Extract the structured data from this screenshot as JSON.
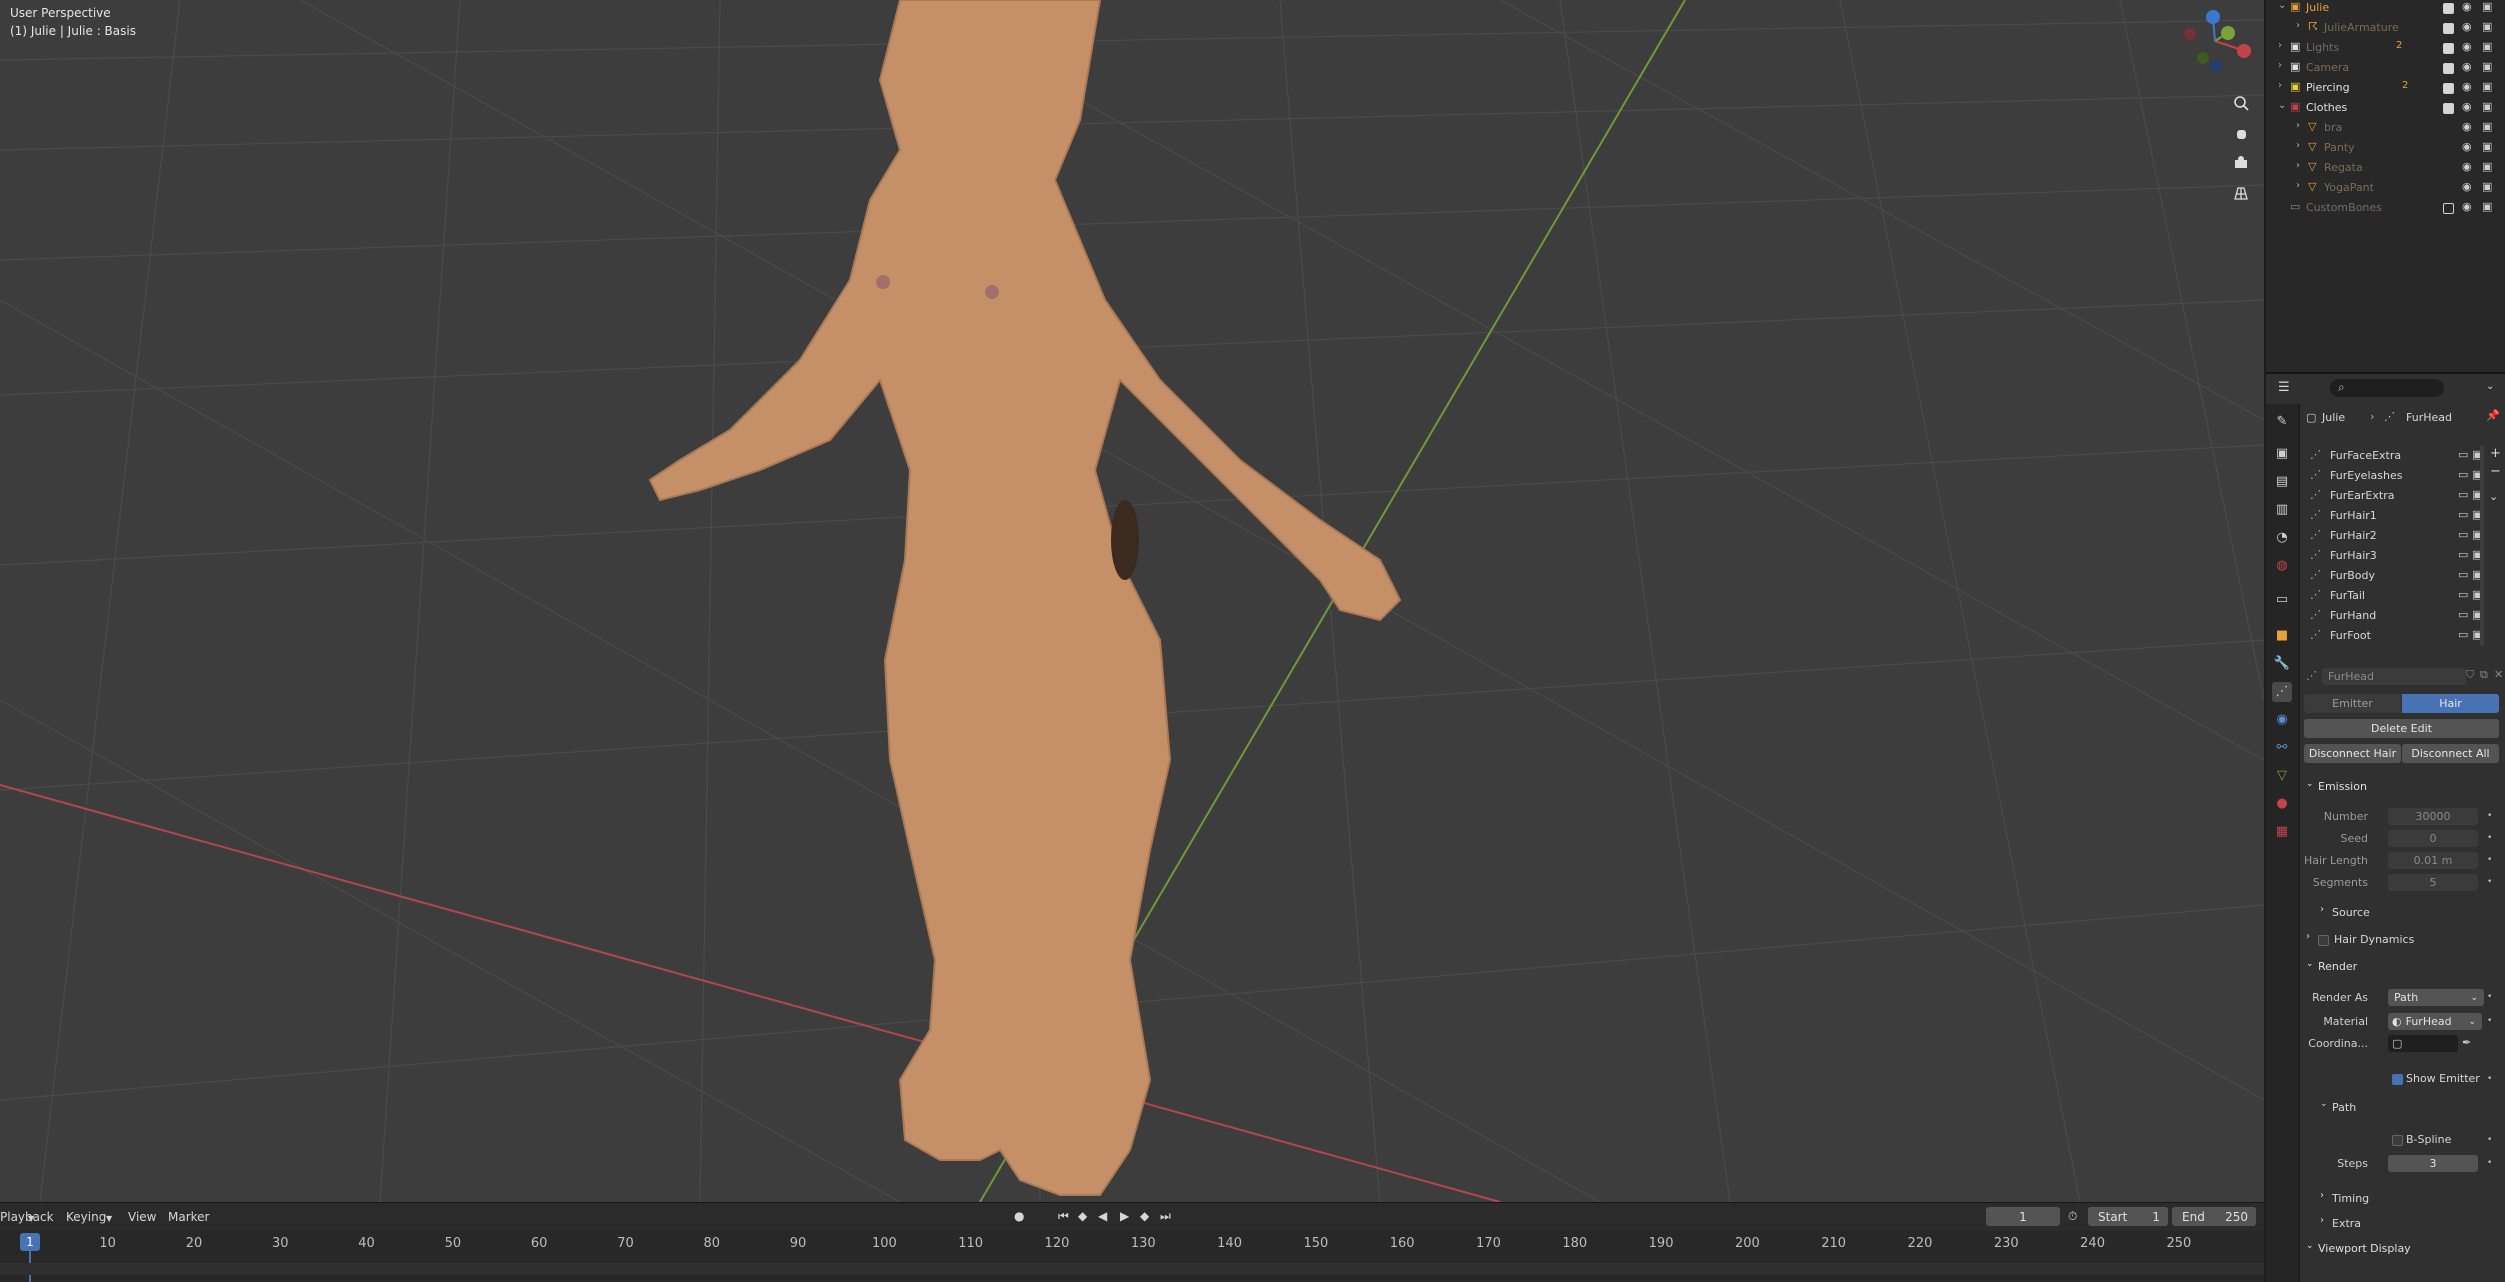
{
  "viewport": {
    "view_name": "User Perspective",
    "object_info": "(1) Julie | Julie : Basis",
    "gizmo": {
      "x_label": "X",
      "y_label": "Y",
      "z_label": "Z"
    }
  },
  "timeline": {
    "menus": [
      "Playback",
      "Keying",
      "View",
      "Marker"
    ],
    "current_frame": "1",
    "start_label": "Start",
    "start_value": "1",
    "end_label": "End",
    "end_value": "250",
    "ticks": [
      "1",
      "10",
      "20",
      "30",
      "40",
      "50",
      "60",
      "70",
      "80",
      "90",
      "100",
      "110",
      "120",
      "130",
      "140",
      "150",
      "160",
      "170",
      "180",
      "190",
      "200",
      "210",
      "220",
      "230",
      "240",
      "250"
    ]
  },
  "outliner": {
    "rows": [
      {
        "label": "Julie",
        "color": "#e8a23a"
      },
      {
        "label": "JulieArmature",
        "color": "#7a6a5a"
      },
      {
        "label": "Lights",
        "color": "#7a6a5a"
      },
      {
        "label": "Camera",
        "color": "#7a6a5a"
      },
      {
        "label": "Piercing",
        "color": "#e0e0e0"
      },
      {
        "label": "Clothes",
        "color": "#e0e0e0"
      },
      {
        "label": "bra",
        "color": "#7a6a5a"
      },
      {
        "label": "Panty",
        "color": "#7a6a5a"
      },
      {
        "label": "Regata",
        "color": "#7a6a5a"
      },
      {
        "label": "YogaPant",
        "color": "#7a6a5a"
      },
      {
        "label": "CustomBones",
        "color": "#7a6a5a"
      }
    ],
    "badges": {
      "lights": "2",
      "piercing": "2"
    }
  },
  "properties": {
    "breadcrumb_object": "Julie",
    "breadcrumb_data": "FurHead",
    "particle_systems": [
      "FurFaceExtra",
      "FurEyelashes",
      "FurEarExtra",
      "FurHair1",
      "FurHair2",
      "FurHair3",
      "FurBody",
      "FurTail",
      "FurHand",
      "FurFoot"
    ],
    "active_system": "FurHead",
    "type_tabs": [
      "Emitter",
      "Hair"
    ],
    "delete_edit": "Delete Edit",
    "disconnect_hair": "Disconnect Hair",
    "disconnect_all": "Disconnect All",
    "emission": {
      "title": "Emission",
      "number_label": "Number",
      "number_value": "30000",
      "seed_label": "Seed",
      "seed_value": "0",
      "hair_length_label": "Hair Length",
      "hair_length_value": "0.01 m",
      "segments_label": "Segments",
      "segments_value": "5",
      "source": "Source"
    },
    "hair_dynamics": "Hair Dynamics",
    "render": {
      "title": "Render",
      "render_as_label": "Render As",
      "render_as_value": "Path",
      "material_label": "Material",
      "material_value": "FurHead",
      "coordinate_label": "Coordina...",
      "show_emitter": "Show Emitter",
      "path_title": "Path",
      "bspline": "B-Spline",
      "steps_label": "Steps",
      "steps_value": "3",
      "timing": "Timing",
      "extra": "Extra"
    },
    "viewport_display": "Viewport Display"
  },
  "colors": {
    "accent": "#4772b3",
    "x_axis": "#c4424a",
    "y_axis": "#7ba23b",
    "z_axis": "#3a78d0",
    "fur": "#c99468"
  }
}
